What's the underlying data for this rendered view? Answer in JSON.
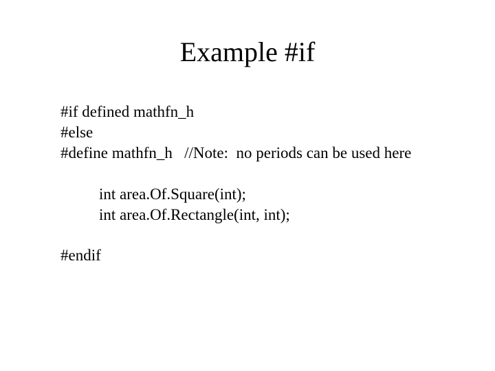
{
  "title": "Example #if",
  "code": {
    "l1": "#if defined mathfn_h",
    "l2": "#else",
    "l3": "#define mathfn_h   //Note:  no periods can be used here",
    "l4": "int area.Of.Square(int);",
    "l5": "int area.Of.Rectangle(int, int);",
    "l6": "#endif"
  }
}
